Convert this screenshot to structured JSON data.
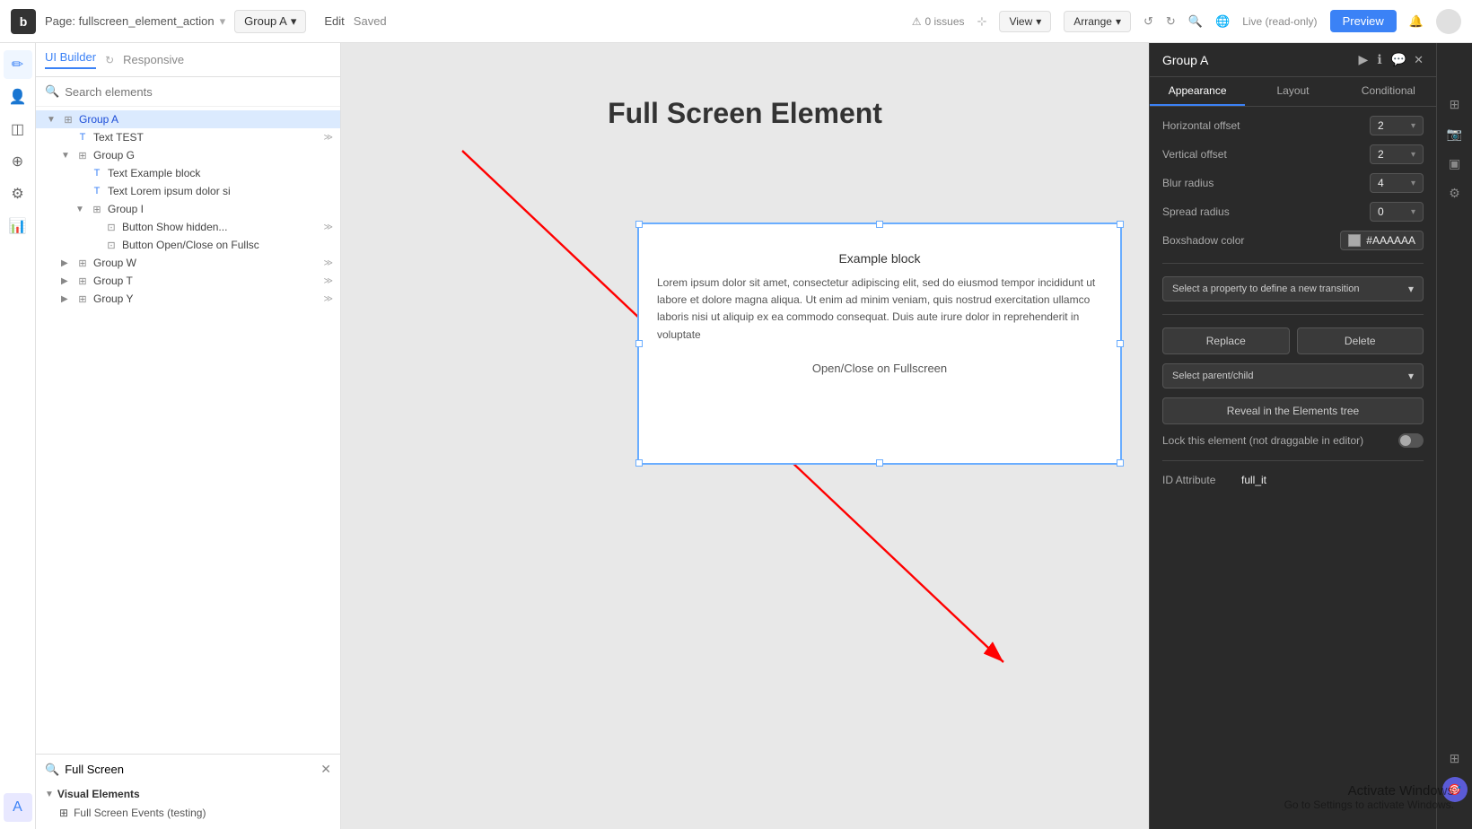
{
  "topbar": {
    "logo": "b",
    "page_label": "Page: fullscreen_element_action",
    "group_label": "Group A",
    "edit_label": "Edit",
    "saved_label": "Saved",
    "issues_label": "0 issues",
    "view_label": "View",
    "arrange_label": "Arrange",
    "live_label": "Live (read-only)",
    "preview_label": "Preview"
  },
  "left_panel": {
    "tab_builder": "UI Builder",
    "tab_responsive": "Responsive",
    "search_placeholder": "Search elements",
    "tree": [
      {
        "indent": 0,
        "toggle": "▼",
        "icon": "⊞",
        "label": "Group A",
        "badge": "",
        "selected": true
      },
      {
        "indent": 1,
        "toggle": "",
        "icon": "T",
        "label": "Text TEST",
        "badge": "≫",
        "selected": false
      },
      {
        "indent": 1,
        "toggle": "▼",
        "icon": "⊞",
        "label": "Group G",
        "badge": "",
        "selected": false
      },
      {
        "indent": 2,
        "toggle": "",
        "icon": "T",
        "label": "Text Example block",
        "badge": "",
        "selected": false
      },
      {
        "indent": 2,
        "toggle": "",
        "icon": "T",
        "label": "Text Lorem ipsum dolor si",
        "badge": "",
        "selected": false
      },
      {
        "indent": 2,
        "toggle": "▼",
        "icon": "⊞",
        "label": "Group I",
        "badge": "",
        "selected": false
      },
      {
        "indent": 3,
        "toggle": "",
        "icon": "⊡",
        "label": "Button Show hidden...",
        "badge": "≫",
        "selected": false
      },
      {
        "indent": 3,
        "toggle": "",
        "icon": "⊡",
        "label": "Button Open/Close on Fullsc",
        "badge": "",
        "selected": false
      },
      {
        "indent": 1,
        "toggle": "▶",
        "icon": "⊞",
        "label": "Group W",
        "badge": "≫",
        "selected": false
      },
      {
        "indent": 1,
        "toggle": "▶",
        "icon": "⊞",
        "label": "Group T",
        "badge": "≫",
        "selected": false
      },
      {
        "indent": 1,
        "toggle": "▶",
        "icon": "⊞",
        "label": "Group Y",
        "badge": "≫",
        "selected": false
      }
    ],
    "fullscreen_search": "Full Screen",
    "visual_elements_label": "Visual Elements",
    "fs_items": [
      "Full Screen Events (testing)"
    ]
  },
  "canvas": {
    "title": "Full Screen Element",
    "example_block_title": "Example block",
    "example_block_body": "Lorem ipsum dolor sit amet, consectetur adipiscing elit, sed do eiusmod tempor incididunt ut labore et dolore magna aliqua. Ut enim ad minim veniam, quis nostrud exercitation ullamco laboris nisi ut aliquip ex ea commodo consequat. Duis aute irure dolor in reprehenderit in voluptate",
    "button_label": "Open/Close on Fullscreen"
  },
  "right_panel": {
    "title": "Group A",
    "tabs": [
      "Appearance",
      "Layout",
      "Conditional"
    ],
    "active_tab": "Appearance",
    "properties": {
      "horizontal_offset_label": "Horizontal offset",
      "horizontal_offset_value": "2",
      "vertical_offset_label": "Vertical offset",
      "vertical_offset_value": "2",
      "blur_radius_label": "Blur radius",
      "blur_radius_value": "4",
      "spread_radius_label": "Spread radius",
      "spread_radius_value": "0",
      "boxshadow_color_label": "Boxshadow color",
      "boxshadow_color_value": "#AAAAAA",
      "transition_placeholder": "Select a property to define a new transition",
      "replace_label": "Replace",
      "delete_label": "Delete",
      "select_parent_label": "Select parent/child",
      "reveal_label": "Reveal in the Elements tree",
      "lock_label": "Lock this element (not draggable in editor)",
      "id_attribute_label": "ID Attribute",
      "id_attribute_value": "full_it"
    }
  },
  "watermark": {
    "title": "Activate Windows",
    "subtitle": "Go to Settings to activate Windows."
  }
}
